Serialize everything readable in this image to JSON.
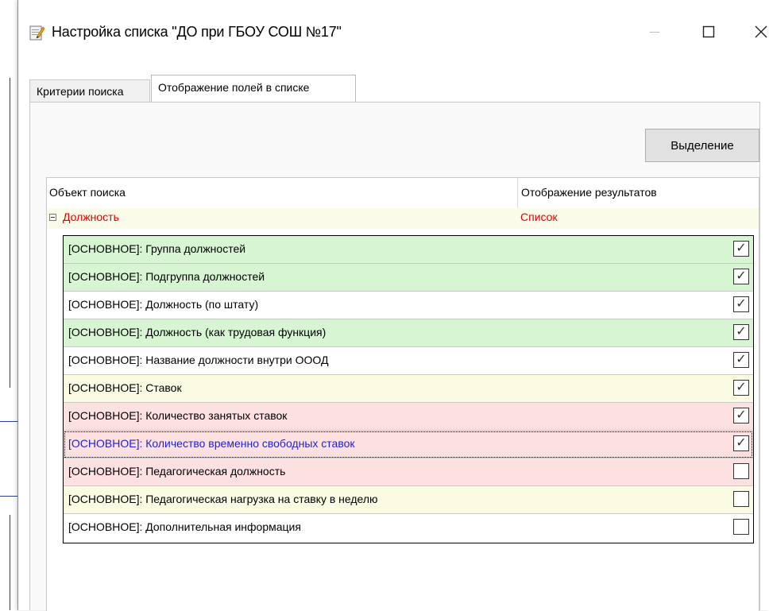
{
  "window": {
    "title": "Настройка списка  \"ДО при ГБОУ СОШ №17\"",
    "minimize_glyph": "—",
    "maximize_glyph": "☐",
    "close_glyph": "X"
  },
  "tabs": [
    {
      "label": "Критерии поиска",
      "active": false
    },
    {
      "label": "Отображение полей в списке",
      "active": true
    }
  ],
  "toolbar": {
    "select_label": "Выделение"
  },
  "grid": {
    "headers": [
      "Объект поиска",
      "Отображение результатов"
    ],
    "parent": {
      "label": "Должность",
      "result": "Список"
    },
    "rows": [
      {
        "label": "[ОСНОВНОЕ]: Группа должностей",
        "checked": true,
        "color": "green"
      },
      {
        "label": "[ОСНОВНОЕ]: Подгруппа должностей",
        "checked": true,
        "color": "green"
      },
      {
        "label": "[ОСНОВНОЕ]: Должность (по штату)",
        "checked": true,
        "color": "white"
      },
      {
        "label": "[ОСНОВНОЕ]: Должность (как трудовая функция)",
        "checked": true,
        "color": "green"
      },
      {
        "label": "[ОСНОВНОЕ]: Название должности внутри ОООД",
        "checked": true,
        "color": "white"
      },
      {
        "label": "[ОСНОВНОЕ]: Ставок",
        "checked": true,
        "color": "yellow"
      },
      {
        "label": "[ОСНОВНОЕ]: Количество занятых ставок",
        "checked": true,
        "color": "pink"
      },
      {
        "label": "[ОСНОВНОЕ]: Количество временно свободных ставок",
        "checked": true,
        "color": "pink",
        "focused": true
      },
      {
        "label": "[ОСНОВНОЕ]: Педагогическая должность",
        "checked": false,
        "color": "pink"
      },
      {
        "label": "[ОСНОВНОЕ]: Педагогическая нагрузка на ставку в неделю",
        "checked": false,
        "color": "yellow"
      },
      {
        "label": "[ОСНОВНОЕ]: Дополнительная информация",
        "checked": false,
        "color": "white"
      }
    ]
  },
  "colors": {
    "parent_text": "#e00000",
    "focused_text": "#1f1fd8",
    "green_row": "#d7f5d3",
    "yellow_row": "#fbfbe3",
    "pink_row": "#fde0e0"
  },
  "check_glyph": "✓"
}
